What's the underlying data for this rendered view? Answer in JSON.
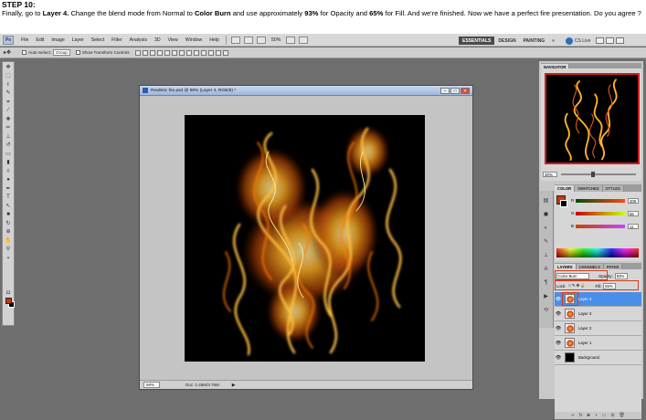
{
  "tutorial": {
    "step_title": "STEP 10:",
    "text_1": "Finally, go to ",
    "bold_1": "Layer 4.",
    "text_2": " Change the blend mode from Normal to ",
    "bold_2": "Color Burn",
    "text_3": " and use approximately ",
    "bold_3": "93%",
    "text_4": " for Opacity and ",
    "bold_4": "65%",
    "text_5": " for Fill.  And we're finished. Now we have a perfect fire presentation. Do you agree ?"
  },
  "menubar": {
    "logo": "Ps",
    "items": [
      "File",
      "Edit",
      "Image",
      "Layer",
      "Select",
      "Filter",
      "Analysis",
      "3D",
      "View",
      "Window",
      "Help"
    ],
    "zoom": "50%"
  },
  "workspaces": {
    "essentials": "ESSENTIALS",
    "design": "DESIGN",
    "painting": "PAINTING",
    "more": "»",
    "cslive": "CS Live"
  },
  "options": {
    "auto_select_label": "Auto-Select:",
    "auto_select_value": "Group",
    "transform_label": "Show Transform Controls"
  },
  "document": {
    "title": "Realistic fire.psd @ 98% (Layer 4, RGB/8) *",
    "zoom": "98%",
    "doc_info": "Doc: 1.45M/3.76M"
  },
  "navigator": {
    "tab": "NAVIGATOR",
    "zoom": "30%"
  },
  "color_panel": {
    "tabs": [
      "COLOR",
      "SWATCHES",
      "STYLES"
    ],
    "r_label": "R",
    "r_value": "200",
    "g_label": "G",
    "g_value": "66",
    "b_label": "B",
    "b_value": "11"
  },
  "layers_panel": {
    "tabs": [
      "LAYERS",
      "CHANNELS",
      "PATHS"
    ],
    "blend_mode": "Color Burn",
    "opacity_label": "Opacity:",
    "opacity_value": "93%",
    "lock_label": "Lock:",
    "fill_label": "Fill:",
    "fill_value": "65%",
    "layers": [
      "Layer 4",
      "Layer 3",
      "Layer 2",
      "Layer 1",
      "Background"
    ]
  },
  "colors": {
    "accent": "#c03c10",
    "highlight": "#4a8ee8",
    "callout": "#d43a1a"
  }
}
